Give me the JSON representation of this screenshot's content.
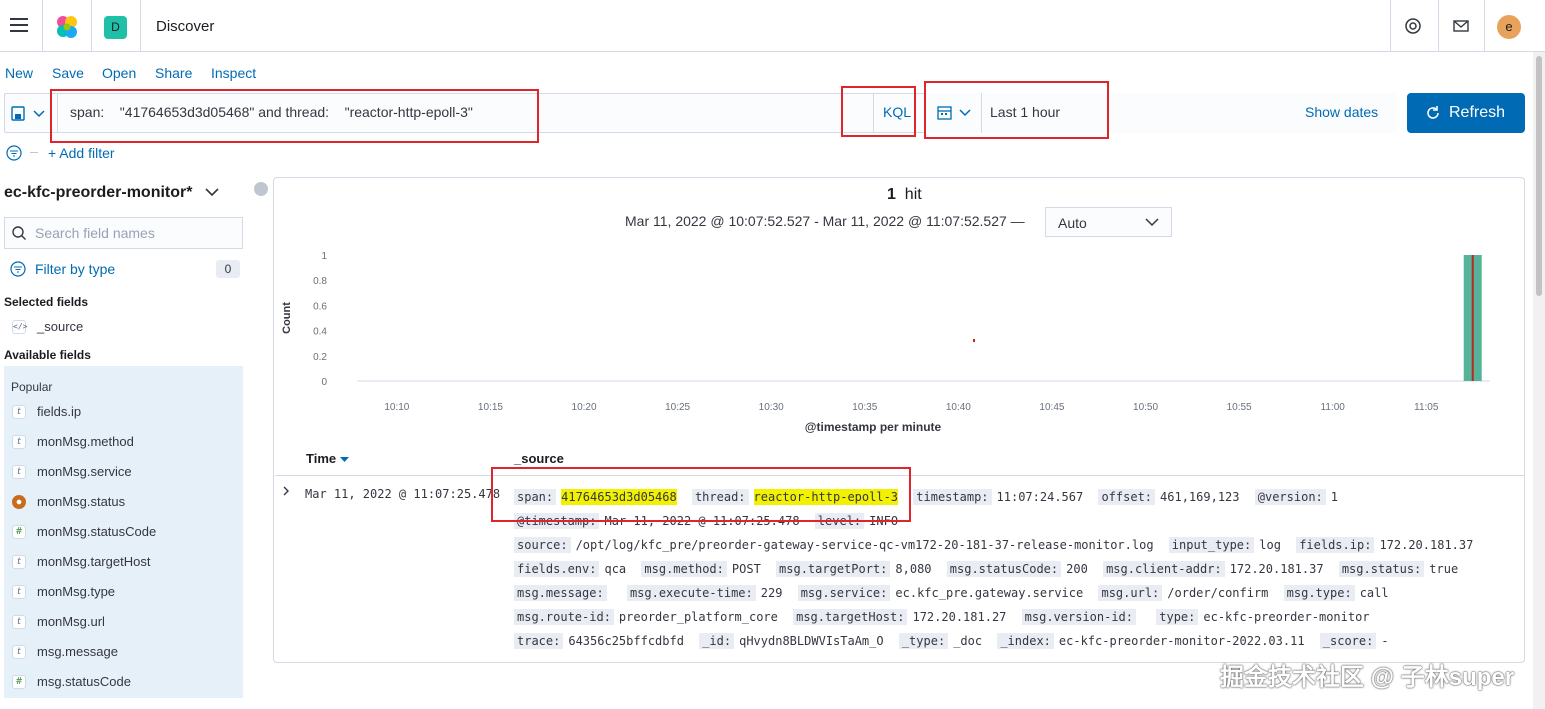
{
  "header": {
    "space_initial": "D",
    "app_title": "Discover",
    "avatar_initial": "e"
  },
  "topnav": [
    "New",
    "Save",
    "Open",
    "Share",
    "Inspect"
  ],
  "query": {
    "text": "span:    \"41764653d3d05468\" and thread:    \"reactor-http-epoll-3\"",
    "language": "KQL",
    "date_label": "Last 1 hour",
    "show_dates": "Show dates",
    "refresh": "Refresh",
    "add_filter": "+ Add filter"
  },
  "sidebar": {
    "index_pattern": "ec-kfc-preorder-monitor*",
    "search_placeholder": "Search field names",
    "filter_by_type": "Filter by type",
    "filter_count": "0",
    "selected_title": "Selected fields",
    "selected_fields": [
      {
        "type": "source",
        "name": "_source"
      }
    ],
    "available_title": "Available fields",
    "popular_title": "Popular",
    "fields": [
      {
        "type": "t",
        "name": "fields.ip"
      },
      {
        "type": "t",
        "name": "monMsg.method"
      },
      {
        "type": "t",
        "name": "monMsg.service"
      },
      {
        "type": "bool",
        "name": "monMsg.status"
      },
      {
        "type": "#",
        "name": "monMsg.statusCode"
      },
      {
        "type": "t",
        "name": "monMsg.targetHost"
      },
      {
        "type": "t",
        "name": "monMsg.type"
      },
      {
        "type": "t",
        "name": "monMsg.url"
      },
      {
        "type": "t",
        "name": "msg.message"
      },
      {
        "type": "#",
        "name": "msg.statusCode"
      }
    ]
  },
  "results": {
    "hit_count": "1",
    "hit_label": "hit",
    "range": "Mar 11, 2022 @ 10:07:52.527 - Mar 11, 2022 @ 11:07:52.527 —",
    "interval": "Auto",
    "col_time": "Time",
    "col_source": "_source",
    "row_time": "Mar 11, 2022 @ 11:07:25.478"
  },
  "chart_data": {
    "type": "bar",
    "xlabel": "@timestamp per minute",
    "ylabel": "Count",
    "ylim": [
      0,
      1
    ],
    "yticks": [
      "0",
      "0.2",
      "0.4",
      "0.6",
      "0.8",
      "1"
    ],
    "xticks": [
      "10:10",
      "10:15",
      "10:20",
      "10:25",
      "10:30",
      "10:35",
      "10:40",
      "10:45",
      "10:50",
      "10:55",
      "11:00",
      "11:05"
    ],
    "categories": [
      "11:07"
    ],
    "values": [
      1
    ],
    "bar_color": "#54b399"
  },
  "doc": [
    {
      "k": "span:",
      "v": "41764653d3d05468",
      "hl": true
    },
    {
      "k": "thread:",
      "v": "reactor-http-epoll-3",
      "hl": true
    },
    {
      "k": "timestamp:",
      "v": "11:07:24.567"
    },
    {
      "k": "offset:",
      "v": "461,169,123"
    },
    {
      "k": "@version:",
      "v": "1"
    },
    {
      "k": "@timestamp:",
      "v": "Mar 11, 2022 @ 11:07:25.478"
    },
    {
      "k": "level:",
      "v": "INFO"
    },
    {
      "k": "source:",
      "v": "/opt/log/kfc_pre/preorder-gateway-service-qc-vm172-20-181-37-release-monitor.log"
    },
    {
      "k": "input_type:",
      "v": "log"
    },
    {
      "k": "fields.ip:",
      "v": "172.20.181.37"
    },
    {
      "k": "fields.env:",
      "v": "qca"
    },
    {
      "k": "msg.method:",
      "v": "POST"
    },
    {
      "k": "msg.targetPort:",
      "v": "8,080"
    },
    {
      "k": "msg.statusCode:",
      "v": "200"
    },
    {
      "k": "msg.client-addr:",
      "v": "172.20.181.37"
    },
    {
      "k": "msg.status:",
      "v": "true"
    },
    {
      "k": "msg.message:",
      "v": ""
    },
    {
      "k": "msg.execute-time:",
      "v": "229"
    },
    {
      "k": "msg.service:",
      "v": "ec.kfc_pre.gateway.service"
    },
    {
      "k": "msg.url:",
      "v": "/order/confirm"
    },
    {
      "k": "msg.type:",
      "v": "call"
    },
    {
      "k": "msg.route-id:",
      "v": "preorder_platform_core"
    },
    {
      "k": "msg.targetHost:",
      "v": "172.20.181.27"
    },
    {
      "k": "msg.version-id:",
      "v": ""
    },
    {
      "k": "type:",
      "v": "ec-kfc-preorder-monitor"
    },
    {
      "k": "trace:",
      "v": "64356c25bffcdbfd"
    },
    {
      "k": "_id:",
      "v": "qHvydn8BLDWVIsTaAm_O"
    },
    {
      "k": "_type:",
      "v": "_doc"
    },
    {
      "k": "_index:",
      "v": "ec-kfc-preorder-monitor-2022.03.11"
    },
    {
      "k": "_score:",
      "v": "-"
    }
  ],
  "watermark": "掘金技术社区 @ 子林super",
  "colors": {
    "accent": "#006bb4",
    "highlight_box": "#e0242c",
    "hit_highlight": "#f2f200"
  }
}
